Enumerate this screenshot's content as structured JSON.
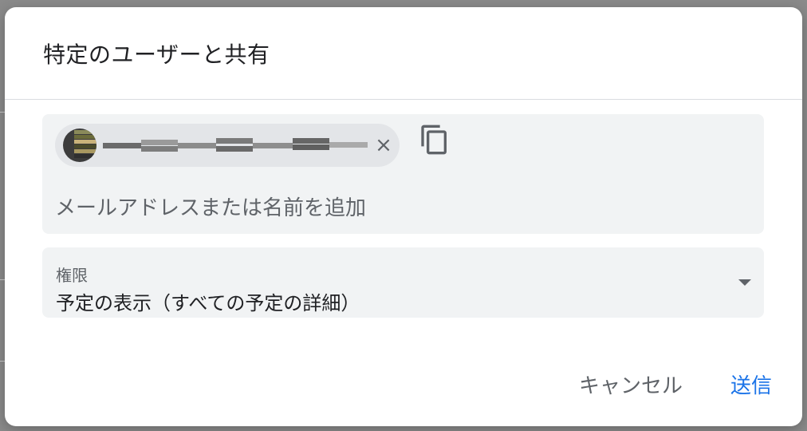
{
  "dialog": {
    "title": "特定のユーザーと共有"
  },
  "recipients": {
    "chip": {
      "avatar_icon": "avatar-icon",
      "remove_icon": "close-icon",
      "remove_glyph": "×",
      "name_redacted": true
    },
    "copy_icon": "copy-icon",
    "input_placeholder": "メールアドレスまたは名前を追加",
    "input_value": ""
  },
  "permission": {
    "label": "権限",
    "value": "予定の表示（すべての予定の詳細）",
    "arrow_icon": "dropdown-arrow-icon"
  },
  "actions": {
    "cancel_label": "キャンセル",
    "send_label": "送信"
  },
  "colors": {
    "primary": "#1a73e8",
    "text": "#202124",
    "secondary_text": "#5f6368",
    "field_bg": "#f1f3f4",
    "chip_bg": "#e3e5e8"
  }
}
